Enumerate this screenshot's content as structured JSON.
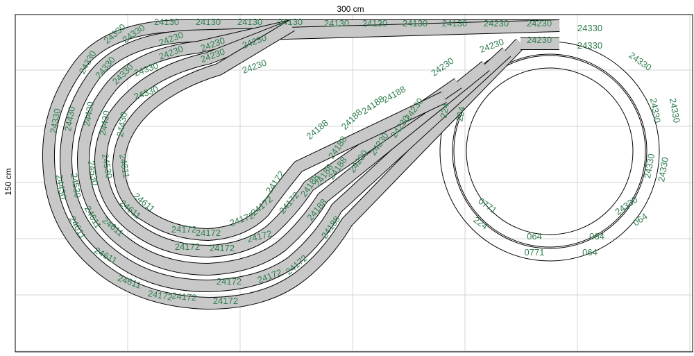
{
  "dimensions": {
    "width_label": "300 cm",
    "height_label": "150 cm"
  },
  "colors": {
    "board_border": "#000000",
    "grid": "#d4d4d4",
    "track_fill_gray": "#c8c8c8",
    "track_fill_white": "#ffffff",
    "track_stroke": "#000000",
    "label": "#2f7f4f"
  },
  "piece_labels": [
    {
      "text": "24130"
    },
    {
      "text": "24130"
    },
    {
      "text": "24130"
    },
    {
      "text": "24130"
    },
    {
      "text": "24130"
    },
    {
      "text": "24130"
    },
    {
      "text": "24130"
    },
    {
      "text": "24130"
    },
    {
      "text": "24230"
    },
    {
      "text": "24230"
    },
    {
      "text": "24230"
    },
    {
      "text": "24230"
    },
    {
      "text": "24230"
    },
    {
      "text": "24230"
    },
    {
      "text": "24230"
    },
    {
      "text": "24230"
    },
    {
      "text": "24330"
    },
    {
      "text": "24330"
    },
    {
      "text": "24330"
    },
    {
      "text": "24330"
    },
    {
      "text": "24330"
    },
    {
      "text": "24330"
    },
    {
      "text": "24330"
    },
    {
      "text": "24330"
    },
    {
      "text": "24430"
    },
    {
      "text": "24430"
    },
    {
      "text": "24430"
    },
    {
      "text": "24430"
    },
    {
      "text": "24430"
    },
    {
      "text": "24530"
    },
    {
      "text": "24530"
    },
    {
      "text": "24530"
    },
    {
      "text": "24611"
    },
    {
      "text": "24611"
    },
    {
      "text": "24611"
    },
    {
      "text": "24611"
    },
    {
      "text": "24611"
    },
    {
      "text": "24611"
    },
    {
      "text": "24611"
    },
    {
      "text": "24611"
    },
    {
      "text": "24172"
    },
    {
      "text": "24172"
    },
    {
      "text": "24172"
    },
    {
      "text": "24172"
    },
    {
      "text": "24172"
    },
    {
      "text": "24172"
    },
    {
      "text": "24172"
    },
    {
      "text": "24172"
    },
    {
      "text": "24172"
    },
    {
      "text": "24172"
    },
    {
      "text": "24172"
    },
    {
      "text": "24172"
    },
    {
      "text": "24172"
    },
    {
      "text": "24172"
    },
    {
      "text": "24172"
    },
    {
      "text": "24188"
    },
    {
      "text": "24188"
    },
    {
      "text": "24188"
    },
    {
      "text": "24188"
    },
    {
      "text": "24188"
    },
    {
      "text": "24188"
    },
    {
      "text": "24188"
    },
    {
      "text": "24188"
    },
    {
      "text": "24188"
    },
    {
      "text": "24188"
    },
    {
      "text": "24230"
    },
    {
      "text": "24230"
    },
    {
      "text": "24230"
    },
    {
      "text": "24230"
    },
    {
      "text": "24230"
    },
    {
      "text": "24230"
    },
    {
      "text": "24230"
    },
    {
      "text": "24330"
    },
    {
      "text": "24330"
    },
    {
      "text": "24330"
    },
    {
      "text": "24330"
    },
    {
      "text": "24330"
    },
    {
      "text": "24330"
    },
    {
      "text": "24330"
    },
    {
      "text": "24330"
    },
    {
      "text": "064"
    },
    {
      "text": "064"
    },
    {
      "text": "064"
    },
    {
      "text": "064"
    },
    {
      "text": "0771"
    },
    {
      "text": "0771"
    },
    {
      "text": "224"
    },
    {
      "text": "224"
    },
    {
      "text": "224"
    }
  ]
}
